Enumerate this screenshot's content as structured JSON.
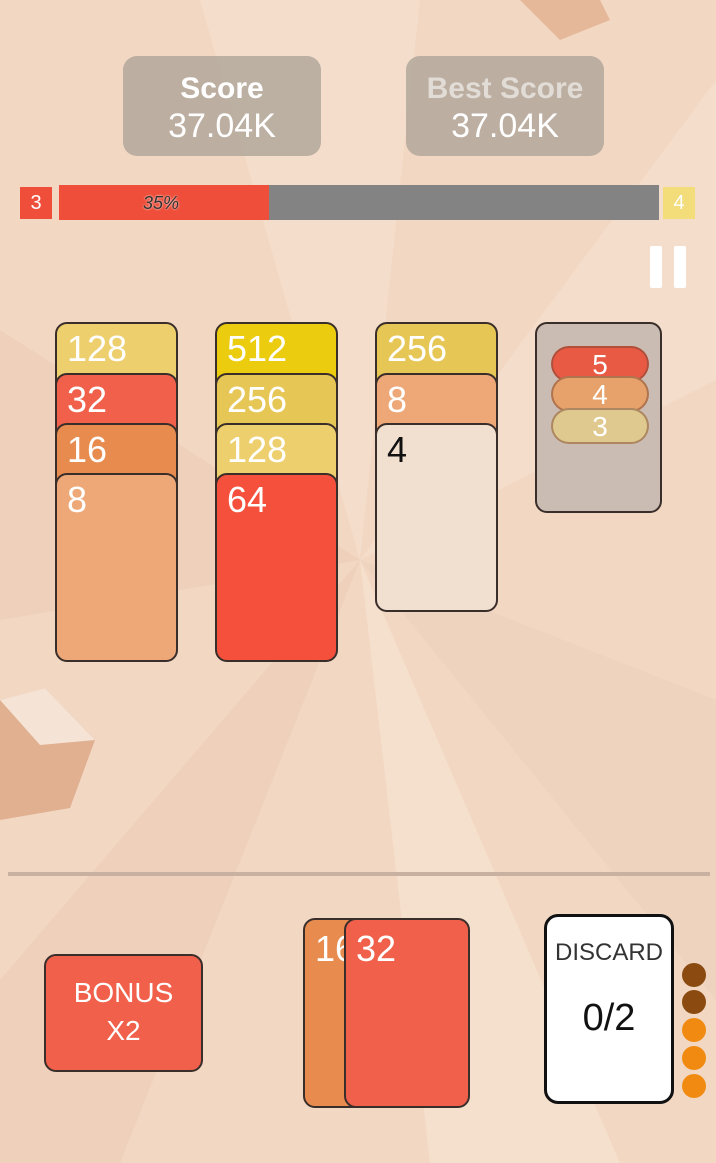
{
  "score": {
    "label": "Score",
    "value": "37.04K"
  },
  "best_score": {
    "label": "Best Score",
    "value": "37.04K"
  },
  "level": {
    "current": "3",
    "next": "4",
    "progress_text": "35%",
    "progress_fraction": 0.35
  },
  "columns": [
    {
      "cards": [
        {
          "value": "128",
          "color": "#edcf6e"
        },
        {
          "value": "32",
          "color": "#f1604a"
        },
        {
          "value": "16",
          "color": "#e88b4f"
        },
        {
          "value": "8",
          "color": "#eea878"
        }
      ]
    },
    {
      "cards": [
        {
          "value": "512",
          "color": "#eccc0f"
        },
        {
          "value": "256",
          "color": "#e6c655"
        },
        {
          "value": "128",
          "color": "#edcf6e"
        },
        {
          "value": "64",
          "color": "#f5503c"
        }
      ]
    },
    {
      "cards": [
        {
          "value": "256",
          "color": "#e6c655"
        },
        {
          "value": "8",
          "color": "#eea878"
        },
        {
          "value": "4",
          "color": "#f1dfd0"
        }
      ]
    }
  ],
  "next_cards": [
    {
      "value": "5",
      "color": "#e95a45"
    },
    {
      "value": "4",
      "color": "#e6a26a"
    },
    {
      "value": "3",
      "color": "#e0c98e"
    }
  ],
  "bonus": {
    "line1": "BONUS",
    "line2": "X2"
  },
  "hand": [
    {
      "value": "16",
      "color": "#e88b4f"
    },
    {
      "value": "32",
      "color": "#f1604a"
    }
  ],
  "discard": {
    "label": "DISCARD",
    "count": "0/2"
  },
  "discard_dots": [
    "#8a4a10",
    "#8a4a10",
    "#f08a10",
    "#f08a10",
    "#f08a10"
  ],
  "icons": {
    "pause": "pause-icon"
  }
}
